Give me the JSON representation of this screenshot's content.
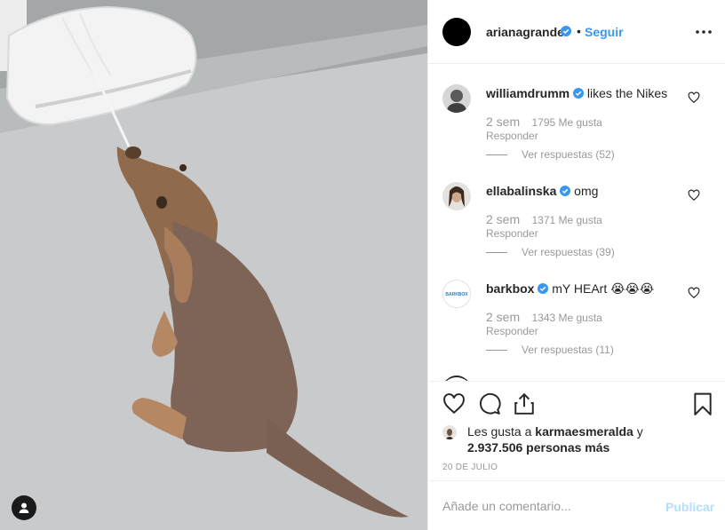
{
  "post": {
    "username": "arianagrande",
    "separator": "•",
    "follow_label": "Seguir"
  },
  "comments": [
    {
      "username": "williamdrumm",
      "text": "likes the Nikes",
      "time": "2 sem",
      "likes": "1795 Me gusta",
      "reply_label": "Responder",
      "replies_label": "Ver respuestas (52)"
    },
    {
      "username": "ellabalinska",
      "text": "omg",
      "time": "2 sem",
      "likes": "1371 Me gusta",
      "reply_label": "Responder",
      "replies_label": "Ver respuestas (39)"
    },
    {
      "username": "barkbox",
      "text": "mY HEArt 😭😭😭",
      "avatar_text": "BARKBOX",
      "time": "2 sem",
      "likes": "1343 Me gusta",
      "reply_label": "Responder",
      "replies_label": "Ver respuestas (11)"
    }
  ],
  "likes_line": {
    "prefix": "Les gusta a",
    "user": "karmaesmeralda",
    "suffix": "y",
    "count": "2.937.506 personas más"
  },
  "date": "20 DE JULIO",
  "comment_box": {
    "placeholder": "Añade un comentario...",
    "publish_label": "Publicar"
  },
  "colors": {
    "link_blue": "#3897f0",
    "verified_blue": "#3897f0",
    "publish_disabled": "#b2dffc",
    "muted_text": "#999999"
  },
  "icons": [
    "heart-icon",
    "comment-icon",
    "share-icon",
    "bookmark-icon",
    "more-options-icon",
    "verified-badge-icon",
    "tag-user-icon"
  ]
}
